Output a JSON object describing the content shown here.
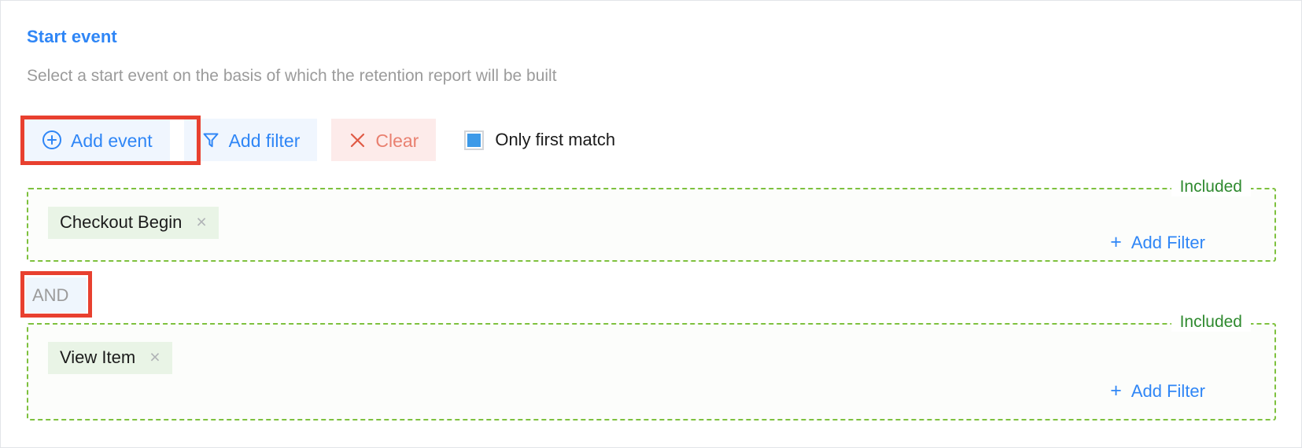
{
  "header": {
    "title": "Start event",
    "description": "Select a start event on the basis of which the retention report will be built",
    "title_color": "#2f86f6",
    "description_color": "#9b9b9b"
  },
  "toolbar": {
    "add_event_label": "Add event",
    "add_filter_label": "Add filter",
    "clear_label": "Clear",
    "only_first_match_label": "Only first match",
    "only_first_match_checked": true,
    "checkbox_fill_color": "#3d9ae8",
    "button_blue_bg": "#f0f6fe",
    "button_blue_fg": "#2f86f6",
    "button_red_bg": "#fdebea",
    "button_red_fg": "#e98070"
  },
  "annotations": {
    "highlight_color": "#e8402f",
    "highlighted_elements": [
      "Add event",
      "AND"
    ]
  },
  "operator": {
    "and_label": "AND",
    "bg_color": "#eff6fd",
    "text_color": "#9b9b9b"
  },
  "groups": [
    {
      "legend": "Included",
      "legend_color": "#2f8a2f",
      "border_color": "#7ec13e",
      "chip_label": "Checkout Begin",
      "chip_remove_icon": "×",
      "chip_bg": "#e9f4e6",
      "add_filter_label": "Add Filter",
      "add_filter_plus": "+"
    },
    {
      "legend": "Included",
      "legend_color": "#2f8a2f",
      "border_color": "#7ec13e",
      "chip_label": "View Item",
      "chip_remove_icon": "×",
      "chip_bg": "#e9f4e6",
      "add_filter_label": "Add Filter",
      "add_filter_plus": "+"
    }
  ]
}
